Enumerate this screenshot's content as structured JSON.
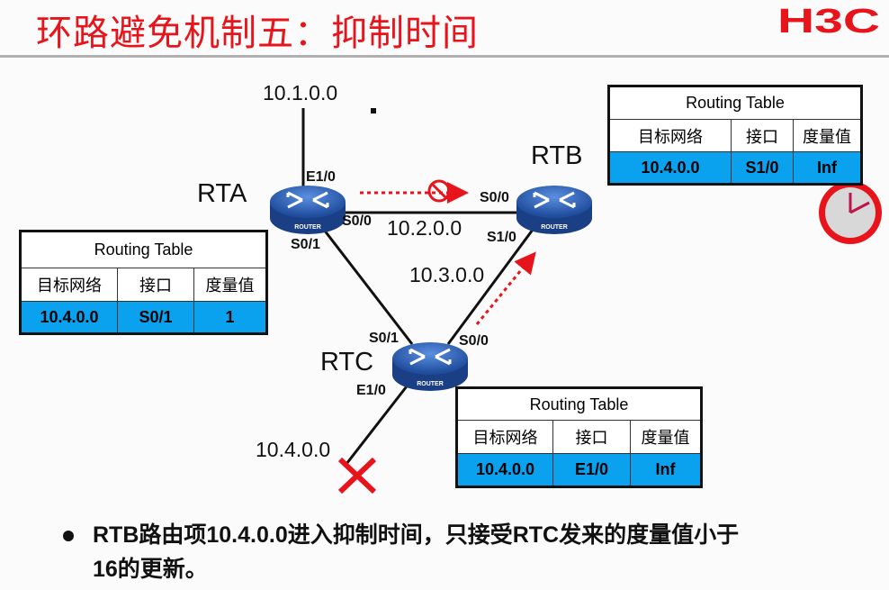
{
  "title": "环路避免机制五：抑制时间",
  "logo": "H3C",
  "colors": {
    "title": "#e8141b",
    "table_highlight": "#0aa2ef",
    "router": "#2f5fb3",
    "arrow": "#e8141b"
  },
  "networks": {
    "top": "10.1.0.0",
    "ab": "10.2.0.0",
    "bc": "10.3.0.0",
    "bottom": "10.4.0.0"
  },
  "routers": {
    "rta": {
      "name": "RTA",
      "ports": {
        "e10": "E1/0",
        "s00": "S0/0",
        "s01": "S0/1"
      }
    },
    "rtb": {
      "name": "RTB",
      "ports": {
        "s00": "S0/0",
        "s10": "S1/0"
      }
    },
    "rtc": {
      "name": "RTC",
      "ports": {
        "s01": "S0/1",
        "s00": "S0/0",
        "e10": "E1/0"
      }
    },
    "icon_label": "ROUTER"
  },
  "tables": {
    "headers": [
      "目标网络",
      "接口",
      "度量值"
    ],
    "title": "Routing Table",
    "rtb": [
      "10.4.0.0",
      "S1/0",
      "Inf"
    ],
    "rta": [
      "10.4.0.0",
      "S0/1",
      "1"
    ],
    "rtc": [
      "10.4.0.0",
      "E1/0",
      "Inf"
    ]
  },
  "icons": [
    "router-icon",
    "forbidden-icon",
    "clock-icon",
    "failure-x-icon"
  ],
  "bullet": "RTB路由项10.4.0.0进入抑制时间，只接受RTC发来的度量值小于16的更新。"
}
